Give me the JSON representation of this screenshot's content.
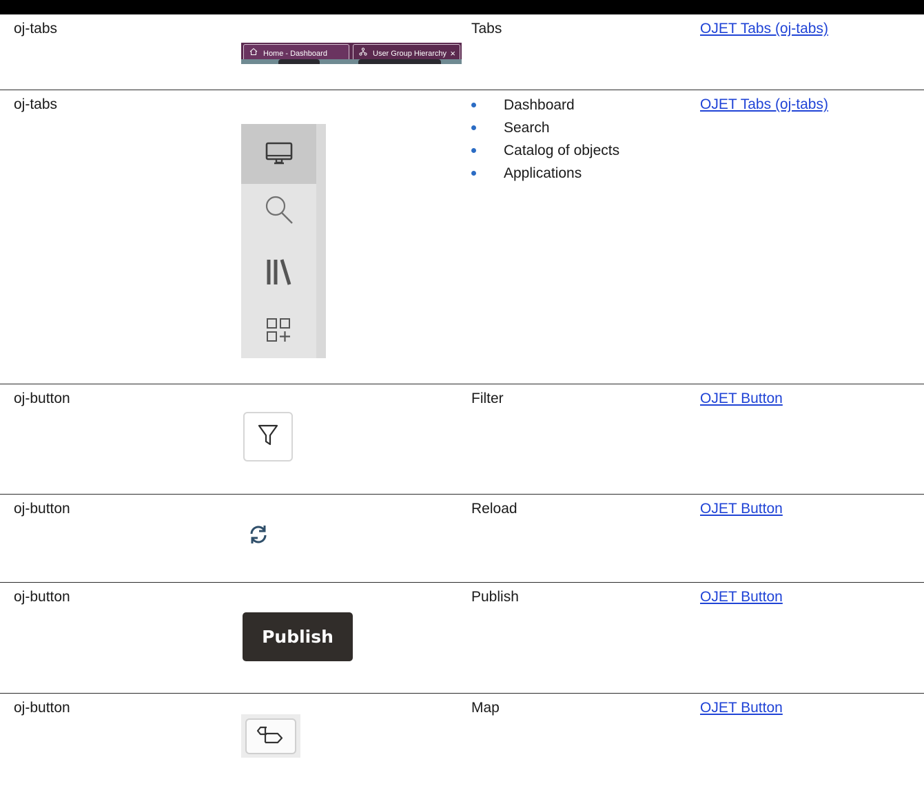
{
  "rows": [
    {
      "component": "oj-tabs",
      "description": "Tabs",
      "link": "OJET Tabs (oj-tabs)",
      "tabs": [
        {
          "label": "Home - Dashboard",
          "icon": "home-icon"
        },
        {
          "label": "User Group Hierarchy",
          "icon": "hierarchy-icon",
          "close": "×"
        }
      ]
    },
    {
      "component": "oj-tabs",
      "items": [
        "Dashboard",
        "Search",
        "Catalog of objects",
        "Applications"
      ],
      "link": "OJET Tabs (oj-tabs)",
      "nav_icons": [
        "monitor-icon",
        "search-icon",
        "library-icon",
        "apps-add-icon"
      ]
    },
    {
      "component": "oj-button",
      "description": "Filter",
      "link": "OJET Button",
      "icon": "filter-icon"
    },
    {
      "component": "oj-button",
      "description": "Reload",
      "link": "OJET Button",
      "icon": "refresh-icon"
    },
    {
      "component": "oj-button",
      "description": "Publish",
      "link": "OJET Button",
      "button_label": "Publish"
    },
    {
      "component": "oj-button",
      "description": "Map",
      "link": "OJET Button",
      "icon": "map-icon"
    }
  ],
  "colors": {
    "link": "#1f43d6",
    "bullet": "#2b6cc4",
    "tab_bar": "#5b2a4f",
    "publish_bg": "#312d2a"
  }
}
